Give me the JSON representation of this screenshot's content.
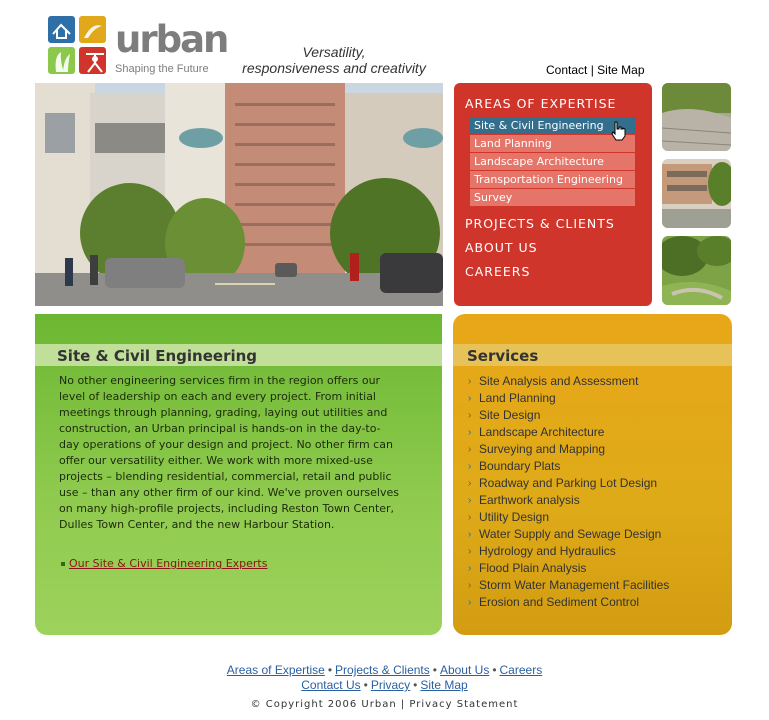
{
  "brand": {
    "name": "urban",
    "tagline": "Shaping the Future",
    "slogan_line1": "Versatility,",
    "slogan_line2": "responsiveness and creativity",
    "colors": {
      "red": "#d0352c",
      "green": "#8cc84b",
      "gold": "#e0a81a",
      "gray": "#7d7d7d",
      "teal": "#336f8c"
    }
  },
  "top_links": {
    "contact": "Contact",
    "separator": "|",
    "site_map": "Site Map"
  },
  "nav": {
    "areas_heading": "AREAS OF EXPERTISE",
    "sub_items": [
      {
        "label": "Site & Civil Engineering",
        "active": true
      },
      {
        "label": "Land Planning",
        "active": false
      },
      {
        "label": "Landscape Architecture",
        "active": false
      },
      {
        "label": "Transportation Engineering",
        "active": false
      },
      {
        "label": "Survey",
        "active": false
      }
    ],
    "projects": "PROJECTS & CLIENTS",
    "about": "ABOUT US",
    "careers": "CAREERS"
  },
  "main": {
    "title": "Site & Civil Engineering",
    "body": "No other engineering services firm in the region offers our level of leadership on each and every project. From initial meetings through planning, grading, laying out utilities and construction, an Urban principal is hands-on in the day-to-day operations of your design and project. No other firm can offer our versatility either. We work with more mixed-use projects – blending residential, commercial, retail and public use – than any other firm of our kind. We've proven ourselves on many high-profile projects, including Reston Town Center, Dulles Town Center, and the new Harbour Station.",
    "experts_link": "Our Site & Civil Engineering Experts"
  },
  "services": {
    "title": "Services",
    "items": [
      "Site Analysis and Assessment",
      "Land Planning",
      "Site Design",
      "Landscape Architecture",
      "Surveying and Mapping",
      "Boundary Plats",
      "Roadway and Parking Lot Design",
      "Earthwork analysis",
      "Utility Design",
      "Water Supply and Sewage Design",
      "Hydrology and Hydraulics",
      "Flood Plain Analysis",
      "Storm Water Management Facilities",
      "Erosion and Sediment Control"
    ]
  },
  "footer": {
    "areas": "Areas of Expertise",
    "projects": "Projects & Clients",
    "about": "About Us",
    "careers": "Careers",
    "contact": "Contact Us",
    "privacy": "Privacy",
    "site_map": "Site Map",
    "dot": "•",
    "copyright": "© Copyright 2006 Urban | Privacy Statement"
  }
}
